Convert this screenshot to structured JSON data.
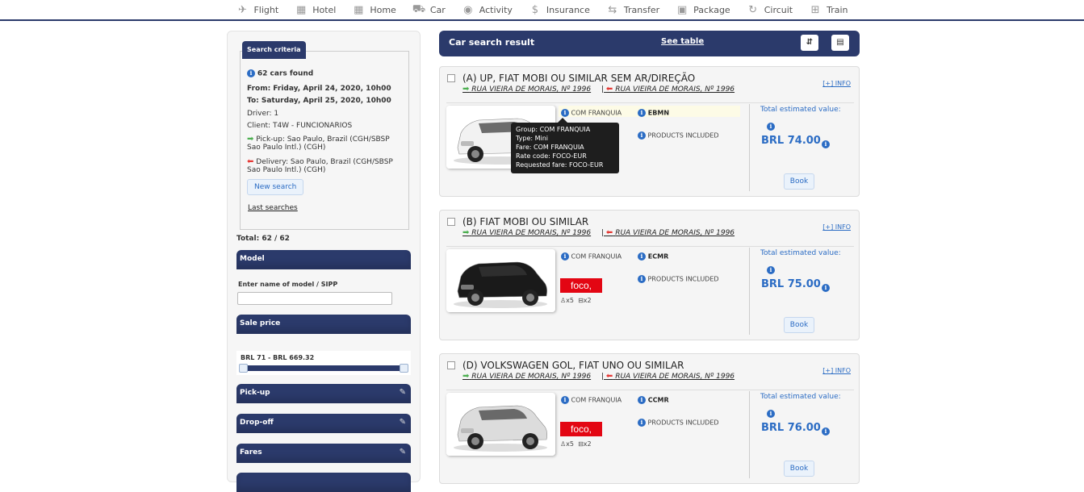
{
  "nav": [
    {
      "icon": "plane-icon",
      "glyph": "✈",
      "label": "Flight"
    },
    {
      "icon": "hotel-icon",
      "glyph": "▦",
      "label": "Hotel"
    },
    {
      "icon": "home-icon",
      "glyph": "▦",
      "label": "Home"
    },
    {
      "icon": "car-icon",
      "glyph": "⛟",
      "label": "Car"
    },
    {
      "icon": "activity-icon",
      "glyph": "◉",
      "label": "Activity"
    },
    {
      "icon": "insurance-icon",
      "glyph": "$",
      "label": "Insurance"
    },
    {
      "icon": "transfer-icon",
      "glyph": "⇆",
      "label": "Transfer"
    },
    {
      "icon": "package-icon",
      "glyph": "▣",
      "label": "Package"
    },
    {
      "icon": "circuit-icon",
      "glyph": "↻",
      "label": "Circuit"
    },
    {
      "icon": "train-icon",
      "glyph": "⊞",
      "label": "Train"
    }
  ],
  "sidebar": {
    "criteria_tab": "Search criteria",
    "found": "62 cars found",
    "from": "From: Friday, April 24, 2020, 10h00",
    "to": "To: Saturday, April 25, 2020, 10h00",
    "driver": "Driver: 1",
    "client": "Client: T4W - FUNCIONARIOS",
    "pickup_l1": "Pick-up: Sao Paulo, Brazil (CGH/SBSP",
    "pickup_l2": "Sao Paulo Intl.) (CGH)",
    "delivery_l1": "Delivery: Sao Paulo, Brazil (CGH/SBSP",
    "delivery_l2": "Sao Paulo Intl.) (CGH)",
    "new_search": "New search",
    "last_searches": "Last searches",
    "total": "Total: 62 / 62",
    "model_header": "Model",
    "model_label": "Enter name of model / SIPP",
    "sale_header": "Sale price",
    "price_range": "BRL 71 - BRL 669.32",
    "price_range_fraction": [
      0,
      1
    ],
    "pickup_header": "Pick-up",
    "dropoff_header": "Drop-off",
    "fares_header": "Fares"
  },
  "main": {
    "title": "Car search result",
    "see_table": "See table",
    "btn1": "⇵",
    "btn2": "▤"
  },
  "cars": [
    {
      "title": "(A) UP, FIAT MOBI OU SIMILAR SEM AR/DIREÇÃO",
      "pickup_addr": "RUA VIEIRA DE MORAIS, Nº 1996",
      "drop_addr": "RUA VIEIRA DE MORAIS, Nº 1996",
      "more_info": "[+] INFO",
      "fare": "COM FRANQUIA",
      "code": "EBMN",
      "products": "PRODUCTS INCLUDED",
      "total_label": "Total estimated value:",
      "price": "BRL 74.00",
      "book": "Book",
      "car_color": "#f2f2f2"
    },
    {
      "title": "(B) FIAT MOBI OU SIMILAR",
      "pickup_addr": "RUA VIEIRA DE MORAIS, Nº 1996",
      "drop_addr": "RUA VIEIRA DE MORAIS, Nº 1996",
      "more_info": "[+] INFO",
      "fare": "COM FRANQUIA",
      "code": "ECMR",
      "products": "PRODUCTS INCLUDED",
      "logo": "foco,",
      "pax": "x5",
      "bags": "x2",
      "total_label": "Total estimated value:",
      "price": "BRL 75.00",
      "book": "Book",
      "car_color": "#1a1a1a"
    },
    {
      "title": "(D) VOLKSWAGEN GOL, FIAT UNO OU SIMILAR",
      "pickup_addr": "RUA VIEIRA DE MORAIS, Nº 1996",
      "drop_addr": "RUA VIEIRA DE MORAIS, Nº 1996",
      "more_info": "[+] INFO",
      "fare": "COM FRANQUIA",
      "code": "CCMR",
      "products": "PRODUCTS INCLUDED",
      "logo": "foco,",
      "pax": "x5",
      "bags": "x2",
      "total_label": "Total estimated value:",
      "price": "BRL 76.00",
      "book": "Book",
      "car_color": "#dcdcdc"
    }
  ],
  "tooltip": {
    "group": "Group: COM FRANQUIA",
    "type": "Type: Mini",
    "fare": "Fare: COM FRANQUIA",
    "rate": "Rate code: FOCO-EUR",
    "requested": "Requested fare: FOCO-EUR"
  }
}
